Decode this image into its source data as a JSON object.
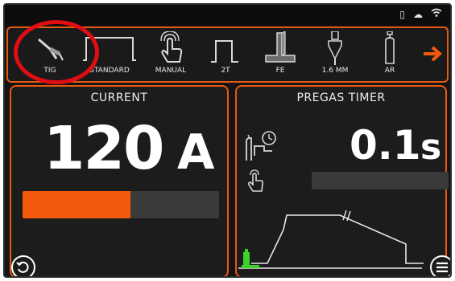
{
  "modes": [
    {
      "id": "tig",
      "label": "TIG",
      "icon": "tig-torch-icon"
    },
    {
      "id": "standard",
      "label": "STANDARD",
      "icon": "standard-waveform-icon"
    },
    {
      "id": "manual",
      "label": "MANUAL",
      "icon": "hand-touch-icon"
    },
    {
      "id": "2t",
      "label": "2T",
      "icon": "trigger-2t-icon"
    },
    {
      "id": "fe",
      "label": "FE",
      "icon": "steel-profile-icon"
    },
    {
      "id": "electrode",
      "label": "1.6 MM",
      "icon": "electrode-icon"
    },
    {
      "id": "gas",
      "label": "AR",
      "icon": "gas-bottle-icon"
    }
  ],
  "current": {
    "title": "CURRENT",
    "value": "120",
    "unit": "A",
    "bar_fill_fraction": 0.55
  },
  "pregas": {
    "title": "PREGAS TIMER",
    "value": "0.1",
    "unit": "s"
  },
  "colors": {
    "accent": "#e65a10",
    "bar": "#f35a0e",
    "highlight": "#e00d12",
    "gas_green": "#3ed12b"
  }
}
